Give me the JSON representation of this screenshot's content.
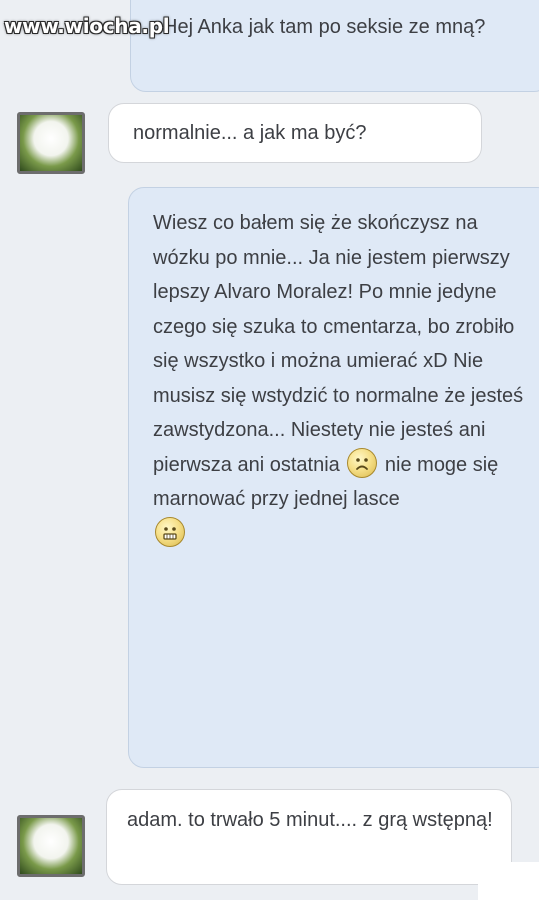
{
  "watermark": "www.wiocha.pl",
  "messages": [
    {
      "from": "me",
      "text": "Hej Anka jak tam po seksie ze mną?"
    },
    {
      "from": "them",
      "text": "normalnie... a jak ma być?"
    },
    {
      "from": "me",
      "text_part1": "Wiesz co bałem się że skończysz na wózku po mnie... Ja nie jestem pierwszy lepszy Alvaro Moralez! Po mnie jedyne czego się szuka to cmentarza, bo zrobiło się wszystko i można umierać xD Nie musisz się wstydzić to normalne że jesteś zawstydzona... Niestety nie jesteś  ani pierwsza ani ostatnia",
      "emoji1": "sad-face-emoji",
      "text_part2": "nie moge się marnować przy jednej lasce",
      "emoji2": "smile-face-emoji"
    },
    {
      "from": "them",
      "text": "adam. to trwało 5 minut.... z grą wstępną!"
    }
  ],
  "colors": {
    "sent_bubble": "#dfe9f6",
    "received_bubble": "#ffffff",
    "background": "#eceff3"
  }
}
